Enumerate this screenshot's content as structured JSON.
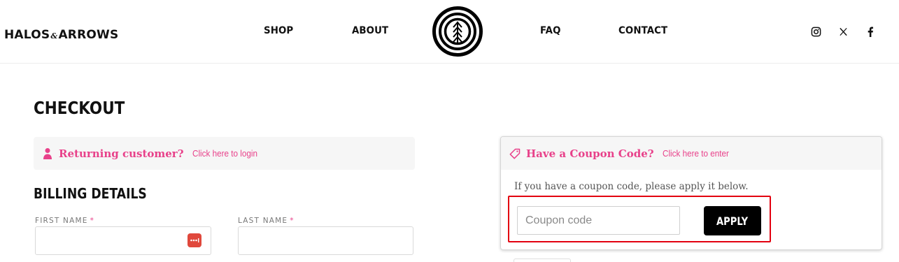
{
  "header": {
    "brand_left": "HALOS",
    "brand_amp": "&",
    "brand_right": "ARROWS",
    "nav": {
      "shop": "SHOP",
      "about": "ABOUT",
      "faq": "FAQ",
      "contact": "CONTACT"
    },
    "social": [
      "instagram-icon",
      "x-twitter-icon",
      "facebook-icon"
    ]
  },
  "page": {
    "title": "CHECKOUT",
    "returning": {
      "strong": "Returning customer?",
      "link": "Click here to login"
    },
    "billing_title": "BILLING DETAILS",
    "fields": {
      "first_name_label": "FIRST NAME",
      "last_name_label": "LAST NAME",
      "required_mark": "*",
      "first_name_value": "",
      "last_name_value": ""
    }
  },
  "coupon": {
    "heading": "Have a Coupon Code?",
    "link": "Click here to enter",
    "description": "If you have a coupon code, please apply it below.",
    "placeholder": "Coupon code",
    "value": "",
    "apply_label": "APPLY"
  },
  "colors": {
    "accent_pink": "#e8418a",
    "highlight_red": "#e3000f",
    "button_black": "#000000",
    "password_badge": "#e0483c"
  }
}
